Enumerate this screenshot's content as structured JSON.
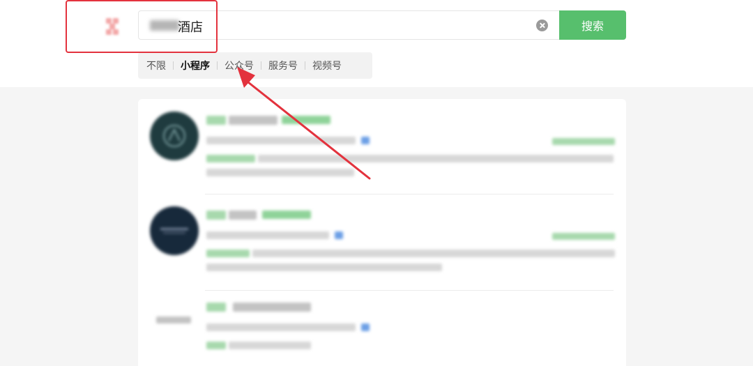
{
  "search": {
    "query_text": "酒店",
    "button_label": "搜索"
  },
  "tabs": [
    {
      "label": "不限",
      "active": false
    },
    {
      "label": "小程序",
      "active": true
    },
    {
      "label": "公众号",
      "active": false
    },
    {
      "label": "服务号",
      "active": false
    },
    {
      "label": "视频号",
      "active": false
    }
  ],
  "colors": {
    "accent_green": "#57bf6d",
    "annotation_red": "#e3323d",
    "link_blue": "#6c9fe6"
  },
  "icons": {
    "clear": "clear-circle-icon",
    "logo": "wechat-search-logo",
    "annotation": "red-arrow"
  },
  "results": [
    {
      "avatar_color": "#1f3b3f"
    },
    {
      "avatar_color": "#17293b"
    },
    {
      "avatar_color": "#ffffff"
    }
  ]
}
